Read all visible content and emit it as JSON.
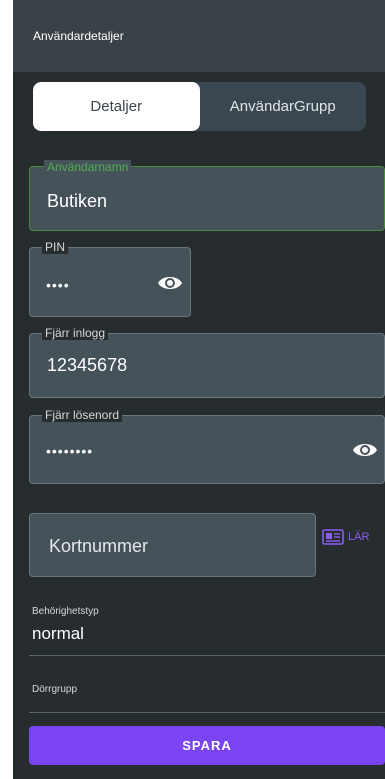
{
  "header": {
    "title": "Användardetaljer"
  },
  "tabs": [
    {
      "label": "Detaljer",
      "active": true
    },
    {
      "label": "AnvändarGrupp",
      "active": false
    }
  ],
  "form": {
    "username": {
      "label": "Användarnamn",
      "value": "Butiken"
    },
    "pin": {
      "label": "PIN",
      "value": "••••"
    },
    "remote_login": {
      "label": "Fjärr inlogg",
      "value": "12345678"
    },
    "remote_password": {
      "label": "Fjärr lösenord",
      "value": "••••••••"
    },
    "card_number": {
      "placeholder": "Kortnummer"
    },
    "learn_label": "LÄR",
    "permission": {
      "label": "Behörighetstyp",
      "value": "normal"
    },
    "door_group": {
      "label": "Dörrgrupp"
    }
  },
  "actions": {
    "save_label": "SPARA"
  },
  "colors": {
    "accent_purple": "#7a44f2",
    "focus_green": "#4caf50",
    "background": "#272c2f",
    "field_bg": "#46525a"
  },
  "icons": [
    "eye-icon",
    "id-card-icon"
  ]
}
